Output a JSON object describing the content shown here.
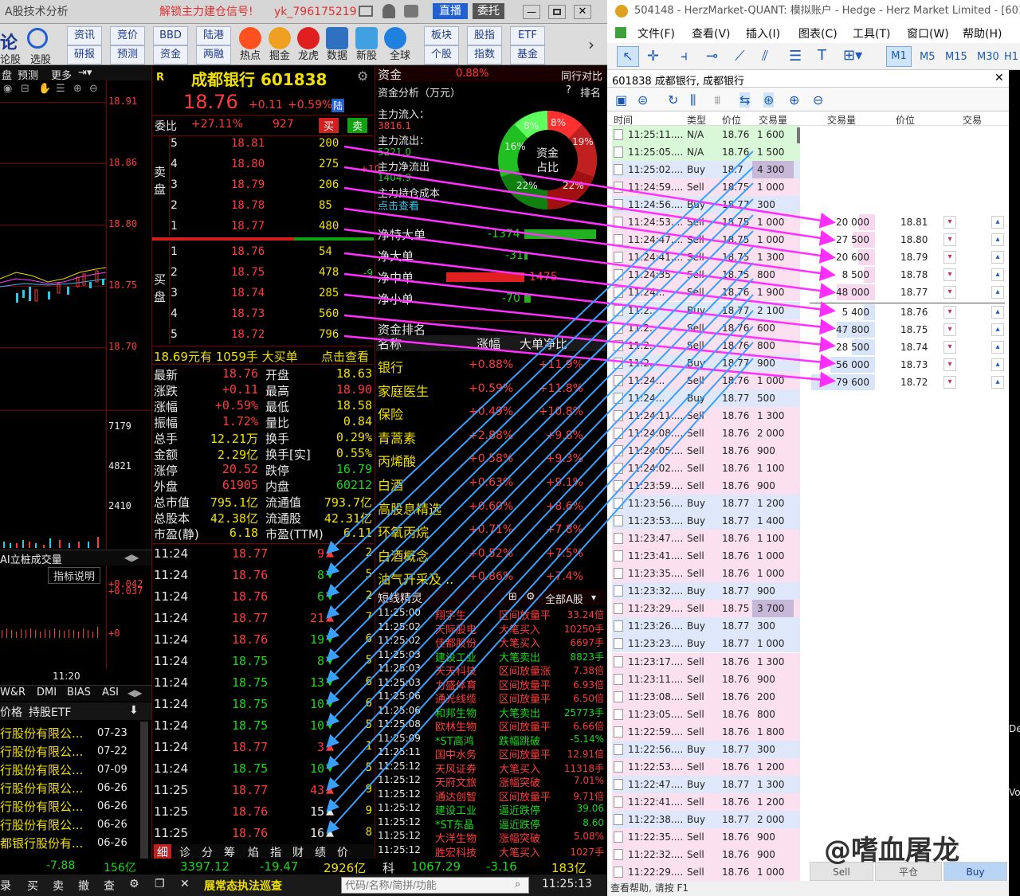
{
  "left_app": {
    "title": "A股技术分析",
    "signal": "解锁主力建仓信号!",
    "user": "yk_796175219",
    "live_btn": "直播",
    "entrust_btn": "委托",
    "toolbar_top": [
      "资讯",
      "竞价",
      "BBD",
      "陆港"
    ],
    "toolbar_bot": [
      "研报",
      "预测",
      "资金",
      "两融"
    ],
    "toolbar_icons": [
      "热点",
      "掘金",
      "龙虎",
      "数据",
      "新股",
      "全球"
    ],
    "toolbar_right_top": [
      "板块",
      "股指",
      "ETF"
    ],
    "toolbar_right_bot": [
      "个股",
      "指数",
      "基金"
    ],
    "left_tab_a": "论",
    "left_tab_b": "选股",
    "left_tab_c": "论股",
    "chart_tabs": [
      "盘",
      "预测",
      "更多"
    ],
    "price_axis": [
      "18.91",
      "18.86",
      "18.80",
      "18.75",
      "18.70"
    ],
    "vol_axis": [
      "7179",
      "4821",
      "2410"
    ],
    "indicator_label": "AI立桩成交量",
    "indicator_help": "指标说明",
    "ind_values": [
      "+0.042",
      "+0.037",
      "+0"
    ],
    "time_label": "11:20",
    "ind_tabs": [
      "W&R",
      "DMI",
      "BIAS",
      "ASI"
    ],
    "holder_tabs": [
      "价格",
      "持股ETF"
    ],
    "holders": [
      {
        "name": "行股份有限公...",
        "date": "07-23"
      },
      {
        "name": "行股份有限公...",
        "date": "07-22"
      },
      {
        "name": "行股份有限公...",
        "date": "07-09"
      },
      {
        "name": "行股份有限公...",
        "date": "06-26"
      },
      {
        "name": "行股份有限公...",
        "date": "06-26"
      },
      {
        "name": "行股份有限公...",
        "date": "06-26"
      },
      {
        "name": "都银行股份有...",
        "date": "06-26"
      }
    ]
  },
  "quote": {
    "marker": "R",
    "name": "成都银行 601838",
    "price": "18.76",
    "change": "+0.11",
    "pct": "+0.59%",
    "badge": "陆",
    "weibi_label": "委比",
    "weibi": "+27.11%",
    "weicha": "927",
    "buy": "买",
    "sell": "卖",
    "sell_side": "卖盘",
    "buy_side": "买盘",
    "asks": [
      [
        "5",
        "18.81",
        "200"
      ],
      [
        "4",
        "18.80",
        "275"
      ],
      [
        "3",
        "18.79",
        "206"
      ],
      [
        "2",
        "18.78",
        "85"
      ],
      [
        "1",
        "18.77",
        "480"
      ]
    ],
    "ask_extra": "+10",
    "bids": [
      [
        "1",
        "18.76",
        "54"
      ],
      [
        "2",
        "18.75",
        "478"
      ],
      [
        "3",
        "18.74",
        "285"
      ],
      [
        "4",
        "18.73",
        "560"
      ],
      [
        "5",
        "18.72",
        "796"
      ]
    ],
    "bid_extra": "-9",
    "bigorder": "18.69元有 1059手 大买单",
    "bigorder_link": "点击查看",
    "stats": [
      [
        "最新",
        "18.76",
        "开盘",
        "18.63"
      ],
      [
        "涨跌",
        "+0.11",
        "最高",
        "18.90"
      ],
      [
        "涨幅",
        "+0.59%",
        "最低",
        "18.58"
      ],
      [
        "振幅",
        "1.72%",
        "量比",
        "0.84"
      ],
      [
        "总手",
        "12.21万",
        "换手",
        "0.29%"
      ],
      [
        "金额",
        "2.29亿",
        "换手[实]",
        "0.55%"
      ],
      [
        "涨停",
        "20.52",
        "跌停",
        "16.79"
      ],
      [
        "外盘",
        "61905",
        "内盘",
        "60212"
      ],
      [
        "总市值",
        "795.1亿",
        "流通值",
        "793.7亿"
      ],
      [
        "总股本",
        "42.38亿",
        "流通股",
        "42.31亿"
      ],
      [
        "市盈(静)",
        "6.18",
        "市盈(TTM)",
        "6.11"
      ]
    ],
    "ticks": [
      [
        "11:24",
        "18.77",
        "9",
        "up"
      ],
      [
        "11:24",
        "18.76",
        "8",
        "dn"
      ],
      [
        "11:24",
        "18.76",
        "6",
        "dn"
      ],
      [
        "11:24",
        "18.77",
        "21",
        "up"
      ],
      [
        "11:24",
        "18.76",
        "19",
        "dn"
      ],
      [
        "11:24",
        "18.75",
        "8",
        "dn"
      ],
      [
        "11:24",
        "18.75",
        "13",
        "dn"
      ],
      [
        "11:24",
        "18.75",
        "10",
        "dn"
      ],
      [
        "11:24",
        "18.75",
        "10",
        "dn"
      ],
      [
        "11:24",
        "18.77",
        "3",
        "up"
      ],
      [
        "11:24",
        "18.75",
        "10",
        "dn"
      ],
      [
        "11:25",
        "18.77",
        "43",
        "up"
      ],
      [
        "11:25",
        "18.76",
        "15",
        "neu"
      ],
      [
        "11:25",
        "18.76",
        "16",
        "neu"
      ]
    ],
    "tick_counts": [
      "2",
      "5",
      "2",
      "7",
      "6",
      "5",
      "6",
      "6",
      "5",
      "1",
      "5",
      "9",
      "9",
      "8"
    ],
    "bottom_tabs": [
      "细",
      "诊",
      "分",
      "筹",
      "焰",
      "指",
      "财",
      "绩",
      "价"
    ]
  },
  "fund": {
    "header": "资金",
    "header_pct": "0.88%",
    "header_right": "同行对比",
    "analysis": "资金分析（万元）",
    "rank": "排名",
    "inflow_label": "主力流入：",
    "inflow": "3816.1",
    "outflow_label": "主力流出：",
    "outflow": "5221.0",
    "net_label": "主力净流出",
    "net": "1404.9",
    "cost_label": "主力持仓成本",
    "cost_link": "点击查看",
    "pie_center1": "资金",
    "pie_center2": "占比",
    "pie_labels": [
      "8%",
      "8%",
      "16%",
      "19%",
      "22%",
      "22%"
    ],
    "flows": [
      [
        "净特大单",
        "-1374"
      ],
      [
        "净大单",
        "-31"
      ],
      [
        "净中单",
        "1475"
      ],
      [
        "净小单",
        "-70"
      ]
    ],
    "rank_title": "资金排名",
    "rank_cols": [
      "名称",
      "涨幅",
      "大单净比"
    ],
    "sectors": [
      [
        "银行",
        "+0.88%",
        "+11.9%"
      ],
      [
        "家庭医生",
        "+0.59%",
        "+11.8%"
      ],
      [
        "保险",
        "+0.49%",
        "+10.8%"
      ],
      [
        "青蒿素",
        "+2.88%",
        "+9.8%"
      ],
      [
        "丙烯酸",
        "+0.58%",
        "+9.3%"
      ],
      [
        "白酒",
        "+0.63%",
        "+9.1%"
      ],
      [
        "高股息精选",
        "+0.60%",
        "+8.6%"
      ],
      [
        "环氧丙烷",
        "+0.71%",
        "+7.8%"
      ],
      [
        "白酒概念",
        "+0.52%",
        "+7.5%"
      ],
      [
        "油气开采及...",
        "+0.86%",
        "+7.4%"
      ]
    ],
    "short_title": "短线精灵",
    "short_right": "全部A股",
    "short_events": [
      [
        "11:25:00",
        "翔宇生",
        "区间放量平",
        "33.24倍"
      ],
      [
        "11:25:02",
        "天际股电",
        "大笔买入",
        "10250手"
      ],
      [
        "11:25:02",
        "佳都股份",
        "大笔买入",
        "6697手"
      ],
      [
        "11:25:03",
        "建设工业",
        "大笔卖出",
        "8823手"
      ],
      [
        "11:25:03",
        "天天科技",
        "区间放量涨",
        "7.38倍"
      ],
      [
        "11:25:03",
        "力盛体育",
        "区间放量平",
        "6.93倍"
      ],
      [
        "11:25:06",
        "通光线缆",
        "区间放量平",
        "6.50倍"
      ],
      [
        "11:25:06",
        "和邦生物",
        "大笔卖出",
        "25773手"
      ],
      [
        "11:25:08",
        "欧林生物",
        "区间放量平",
        "6.66倍"
      ],
      [
        "11:25:09",
        "*ST高鸿",
        "跌幅跳破",
        "-5.14%"
      ],
      [
        "11:25:11",
        "国中水务",
        "区间放量平",
        "12.91倍"
      ],
      [
        "11:25:12",
        "天风证券",
        "大笔买入",
        "11318手"
      ],
      [
        "11:25:12",
        "天府文旅",
        "涨幅突破",
        "7.01%"
      ],
      [
        "11:25:12",
        "通达创智",
        "区间放量平",
        "9.71倍"
      ],
      [
        "11:25:12",
        "建设工业",
        "逼近跌停",
        "39.06"
      ],
      [
        "11:25:12",
        "*ST东晶",
        "逼近跌停",
        "8.60"
      ],
      [
        "11:25:12",
        "大洋生物",
        "涨幅突破",
        "5.08%"
      ],
      [
        "11:25:12",
        "胜宏科技",
        "大笔买入",
        "1027手"
      ]
    ]
  },
  "statusline": {
    "idx1_val": "3397.12",
    "idx1_chg": "-19.47",
    "idx1_amt": "2926亿",
    "idx2_name": "科",
    "idx2_val": "1067.29",
    "idx2_chg": "-3.16",
    "idx2_amt": "183亿",
    "left_vals": [
      "-7.88",
      "156亿"
    ]
  },
  "bottombar": {
    "btns": [
      "录",
      "买",
      "卖",
      "撤",
      "查"
    ],
    "ticker": "展常态执法巡查",
    "search_placeholder": "代码/名称/简拼/功能",
    "time": "11:25:13"
  },
  "mt": {
    "title": "504148 - HerzMarket-QUANT: 模拟账户 - Hedge - Herz Market Limited - [601838",
    "menu": [
      "文件(F)",
      "查看(V)",
      "插入(I)",
      "图表(C)",
      "工具(T)",
      "窗口(W)",
      "帮助(H)"
    ],
    "timeframes": [
      "M1",
      "M5",
      "M15",
      "M30",
      "H1"
    ],
    "window_title": "601838 成都银行, 成都银行",
    "cols": [
      "时间",
      "类型",
      "价位",
      "交易量"
    ],
    "dom_cols": [
      "交易量",
      "价位",
      "交易"
    ],
    "trades": [
      [
        "11:25:11....",
        "N/A",
        "18.76",
        "1 600",
        "na"
      ],
      [
        "11:25:05....",
        "N/A",
        "18.76",
        "1 500",
        "na"
      ],
      [
        "11:25:02....",
        "Buy",
        "18.7",
        "4 300",
        "buy"
      ],
      [
        "11:24:59....",
        "Sell",
        "18.75",
        "1 000",
        "sell"
      ],
      [
        "11:24:56....",
        "Buy",
        "18.77",
        "300",
        "buy"
      ],
      [
        "11:24:53....",
        "Sell",
        "18.75",
        "1 000",
        "sell"
      ],
      [
        "11:24:47....",
        "Sell",
        "18.75",
        "1 000",
        "sell"
      ],
      [
        "11:24:41....",
        "Sell",
        "18.75",
        "1 300",
        "sell"
      ],
      [
        "11:24:35",
        "Sell",
        "18.75",
        "800",
        "sell"
      ],
      [
        "11:24:..",
        "Sell",
        "18.76",
        "1 900",
        "sell"
      ],
      [
        "11:2..",
        "Buy",
        "18.77",
        "2 100",
        "buy"
      ],
      [
        "11:2..",
        "Sell",
        "18.76",
        "600",
        "sell"
      ],
      [
        "11:2..",
        "Sell",
        "18.76",
        "800",
        "sell"
      ],
      [
        "11:2..",
        "Buy",
        "18.77",
        "900",
        "buy"
      ],
      [
        "11:24:..",
        "Sell",
        "18.76",
        "1 000",
        "sell"
      ],
      [
        "11:24:..",
        "Buy",
        "18.77",
        "500",
        "buy"
      ],
      [
        "11:24:11....",
        "Sell",
        "18.76",
        "1 300",
        "sell"
      ],
      [
        "11:24:08....",
        "Sell",
        "18.76",
        "2 000",
        "sell"
      ],
      [
        "11:24:05....",
        "Sell",
        "18.76",
        "900",
        "sell"
      ],
      [
        "11:24:02....",
        "Sell",
        "18.76",
        "1 100",
        "sell"
      ],
      [
        "11:23:59....",
        "Sell",
        "18.76",
        "900",
        "sell"
      ],
      [
        "11:23:56....",
        "Buy",
        "18.77",
        "1 200",
        "buy"
      ],
      [
        "11:23:53....",
        "Buy",
        "18.77",
        "1 400",
        "buy"
      ],
      [
        "11:23:47....",
        "Sell",
        "18.76",
        "1 100",
        "sell"
      ],
      [
        "11:23:41....",
        "Sell",
        "18.76",
        "1 000",
        "sell"
      ],
      [
        "11:23:35....",
        "Sell",
        "18.76",
        "1 000",
        "sell"
      ],
      [
        "11:23:32....",
        "Buy",
        "18.77",
        "900",
        "buy"
      ],
      [
        "11:23:29....",
        "Sell",
        "18.75",
        "3 700",
        "sell"
      ],
      [
        "11:23:26....",
        "Buy",
        "18.77",
        "300",
        "buy"
      ],
      [
        "11:23:23....",
        "Buy",
        "18.77",
        "1 000",
        "buy"
      ],
      [
        "11:23:17....",
        "Sell",
        "18.76",
        "1 300",
        "sell"
      ],
      [
        "11:23:11....",
        "Sell",
        "18.76",
        "900",
        "sell"
      ],
      [
        "11:23:08....",
        "Sell",
        "18.76",
        "200",
        "sell"
      ],
      [
        "11:23:05....",
        "Sell",
        "18.76",
        "800",
        "sell"
      ],
      [
        "11:22:59....",
        "Sell",
        "18.76",
        "1 800",
        "sell"
      ],
      [
        "11:22:56....",
        "Buy",
        "18.77",
        "300",
        "buy"
      ],
      [
        "11:22:53....",
        "Sell",
        "18.76",
        "1 200",
        "sell"
      ],
      [
        "11:22:47....",
        "Buy",
        "18.77",
        "1 300",
        "buy"
      ],
      [
        "11:22:41....",
        "Sell",
        "18.76",
        "1 200",
        "sell"
      ],
      [
        "11:22:38....",
        "Buy",
        "18.77",
        "2 000",
        "buy"
      ],
      [
        "11:22:35....",
        "Sell",
        "18.76",
        "900",
        "sell"
      ],
      [
        "11:22:32....",
        "Sell",
        "18.76",
        "900",
        "sell"
      ],
      [
        "11:22:29....",
        "Sell",
        "18.76",
        "1 000",
        "sell"
      ]
    ],
    "dom": [
      [
        "20 000",
        "18.81"
      ],
      [
        "27 500",
        "18.80"
      ],
      [
        "20 600",
        "18.79"
      ],
      [
        "8 500",
        "18.78"
      ],
      [
        "48 000",
        "18.77"
      ],
      [
        "5 400",
        "18.76"
      ],
      [
        "47 800",
        "18.75"
      ],
      [
        "28 500",
        "18.74"
      ],
      [
        "56 000",
        "18.73"
      ],
      [
        "79 600",
        "18.72"
      ]
    ],
    "buttons": [
      "Sell",
      "平仓",
      "Buy"
    ],
    "status": "查看帮助, 请按 F1",
    "watermark": "@嗜血屠龙",
    "edge_de": "De",
    "edge_vo": "Vo"
  }
}
